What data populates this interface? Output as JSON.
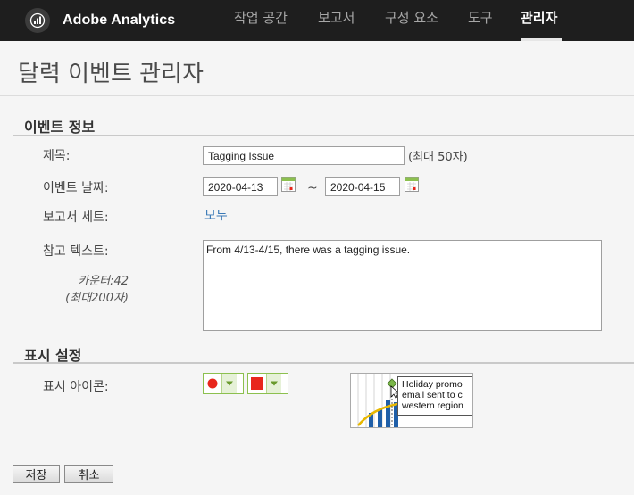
{
  "header": {
    "brand": "Adobe Analytics",
    "nav": [
      {
        "label": "작업 공간"
      },
      {
        "label": "보고서"
      },
      {
        "label": "구성 요소"
      },
      {
        "label": "도구"
      },
      {
        "label": "관리자",
        "active": true
      }
    ]
  },
  "page": {
    "title": "달력 이벤트 관리자"
  },
  "event_info": {
    "section_title": "이벤트 정보",
    "title_label": "제목:",
    "title_value": "Tagging Issue",
    "title_hint": "(최대 50자)",
    "date_label": "이벤트 날짜:",
    "start_date": "2020-04-13",
    "date_separator": "~",
    "end_date": "2020-04-15",
    "report_suite_label": "보고서 세트:",
    "report_suite_value": "모두",
    "notes_label": "참고 텍스트:",
    "counter_line1": "카운터:42",
    "counter_line2": "(최대200자)",
    "notes_value": "From 4/13-4/15, there was a tagging issue."
  },
  "display_settings": {
    "section_title": "표시 설정",
    "icon_label": "표시 아이콘:",
    "selected_icon": "circle",
    "selected_color": "#e8261c",
    "preview_tooltip": "Holiday promo\nemail sent to c\nwestern region"
  },
  "colors": {
    "accent_green": "#8cc04f",
    "link_blue": "#3a79b6",
    "marker_red": "#e8261c",
    "bar_blue": "#1f5fa8",
    "line_yellow": "#e8b800"
  },
  "buttons": {
    "save": "저장",
    "cancel": "취소"
  }
}
